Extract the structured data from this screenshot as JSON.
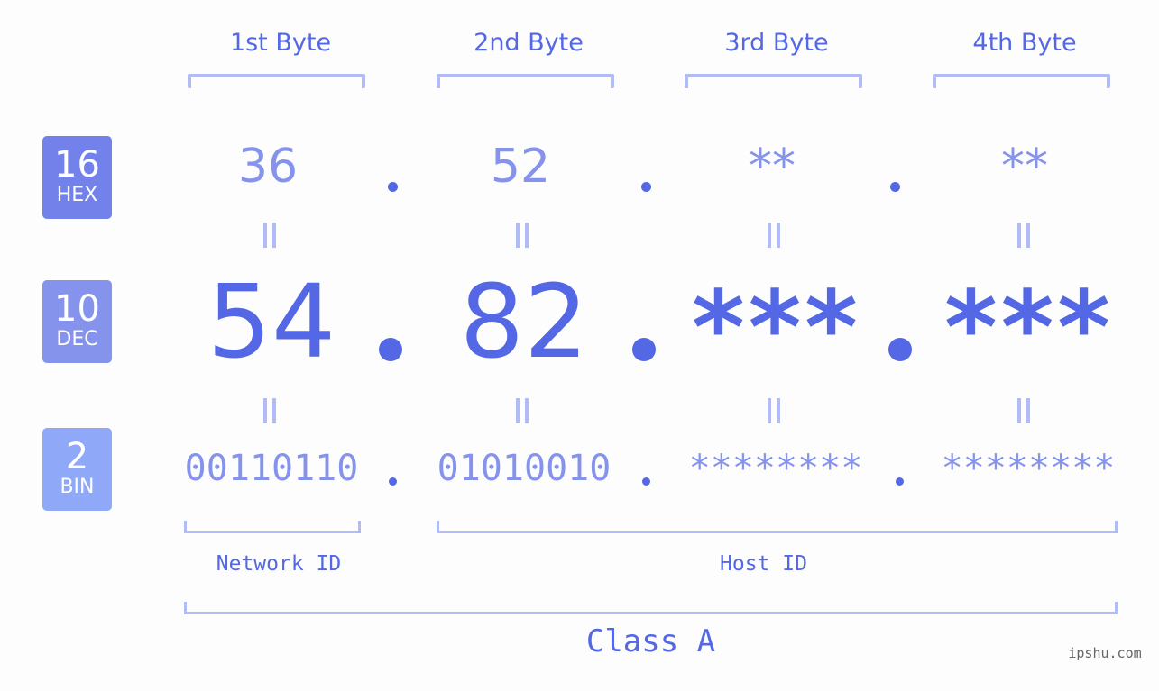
{
  "bytes": {
    "titles": [
      "1st Byte",
      "2nd Byte",
      "3rd Byte",
      "4th Byte"
    ]
  },
  "bases": {
    "hex": {
      "number": "16",
      "label": "HEX",
      "color": "#7382ea"
    },
    "dec": {
      "number": "10",
      "label": "DEC",
      "color": "#8593ec"
    },
    "bin": {
      "number": "2",
      "label": "BIN",
      "color": "#8fa8f8"
    }
  },
  "ip": {
    "hex": [
      "36",
      "52",
      "**",
      "**"
    ],
    "dec": [
      "54",
      "82",
      "***",
      "***"
    ],
    "bin": [
      "00110110",
      "01010010",
      "********",
      "********"
    ],
    "separator": "."
  },
  "segments": {
    "network_id": "Network ID",
    "host_id": "Host ID",
    "class": "Class A"
  },
  "colors": {
    "accent": "#5468e6",
    "light": "#8593ec",
    "bracket": "#b1bbf6",
    "background": "#fcfdfc"
  },
  "watermark": "ipshu.com"
}
